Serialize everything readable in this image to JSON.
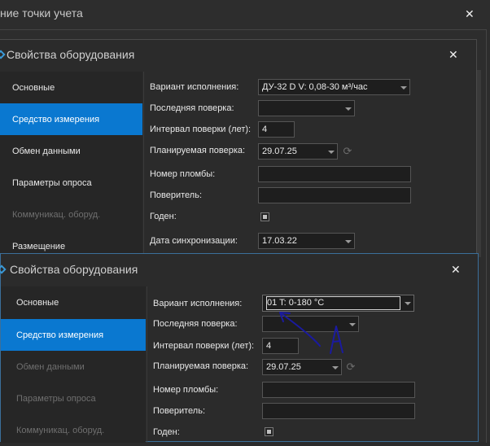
{
  "outer_window": {
    "title": "ние точки учета"
  },
  "dialog1": {
    "title": "Свойства оборудования",
    "nav": [
      "Основные",
      "Средство измерения",
      "Обмен данными",
      "Параметры опроса",
      "Коммуникац. оборуд.",
      "Размещение"
    ],
    "fields": {
      "variant_label": "Вариант исполнения:",
      "variant_value": "ДУ-32 D V: 0,08-30 м³/час",
      "last_check_label": "Последняя поверка:",
      "last_check_value": "",
      "interval_label": "Интервал поверки (лет):",
      "interval_value": "4",
      "planned_label": "Планируемая поверка:",
      "planned_value": "29.07.25",
      "seal_label": "Номер пломбы:",
      "seal_value": "",
      "verifier_label": "Поверитель:",
      "verifier_value": "",
      "valid_label": "Годен:",
      "sync_label": "Дата синхронизации:",
      "sync_value": "17.03.22"
    }
  },
  "dialog2": {
    "title": "Свойства оборудования",
    "nav": [
      "Основные",
      "Средство измерения",
      "Обмен данными",
      "Параметры опроса",
      "Коммуникац. оборуд."
    ],
    "fields": {
      "variant_label": "Вариант исполнения:",
      "variant_value": "01 T: 0-180 °C",
      "last_check_label": "Последняя поверка:",
      "last_check_value": "",
      "interval_label": "Интервал поверки (лет):",
      "interval_value": "4",
      "planned_label": "Планируемая поверка:",
      "planned_value": "29.07.25",
      "seal_label": "Номер пломбы:",
      "seal_value": "",
      "verifier_label": "Поверитель:",
      "verifier_value": "",
      "valid_label": "Годен:"
    },
    "annotation": "А"
  },
  "icons": {
    "close": "close-icon",
    "app": "diamond-icon",
    "refresh": "refresh-icon"
  },
  "colors": {
    "selected_nav": "#0a78d0",
    "annotation_ink": "#1a1aa0"
  }
}
